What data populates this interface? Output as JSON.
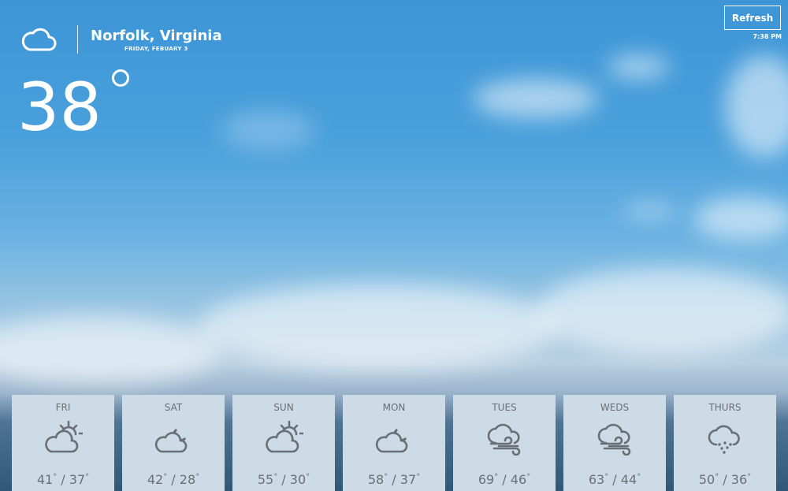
{
  "header": {
    "location": "Norfolk, Virginia",
    "date": "FRIDAY, FEBUARY 3",
    "icon": "cloud-icon"
  },
  "current": {
    "temperature": "38"
  },
  "refresh": {
    "label": "Refresh"
  },
  "time": "7:38 PM",
  "colors": {
    "text_white": "#ffffff",
    "card_bg": "#ccdbe6",
    "card_text": "#6a6f76"
  },
  "forecast": [
    {
      "day": "FRI",
      "high": "41",
      "low": "37",
      "icon": "partly-sunny-icon"
    },
    {
      "day": "SAT",
      "high": "42",
      "low": "28",
      "icon": "partly-cloudy-night-icon"
    },
    {
      "day": "SUN",
      "high": "55",
      "low": "30",
      "icon": "partly-sunny-icon"
    },
    {
      "day": "MON",
      "high": "58",
      "low": "37",
      "icon": "partly-cloudy-night-icon"
    },
    {
      "day": "TUES",
      "high": "69",
      "low": "46",
      "icon": "windy-cloud-icon"
    },
    {
      "day": "WEDS",
      "high": "63",
      "low": "44",
      "icon": "windy-cloud-icon"
    },
    {
      "day": "THURS",
      "high": "50",
      "low": "36",
      "icon": "snow-cloud-icon"
    }
  ]
}
